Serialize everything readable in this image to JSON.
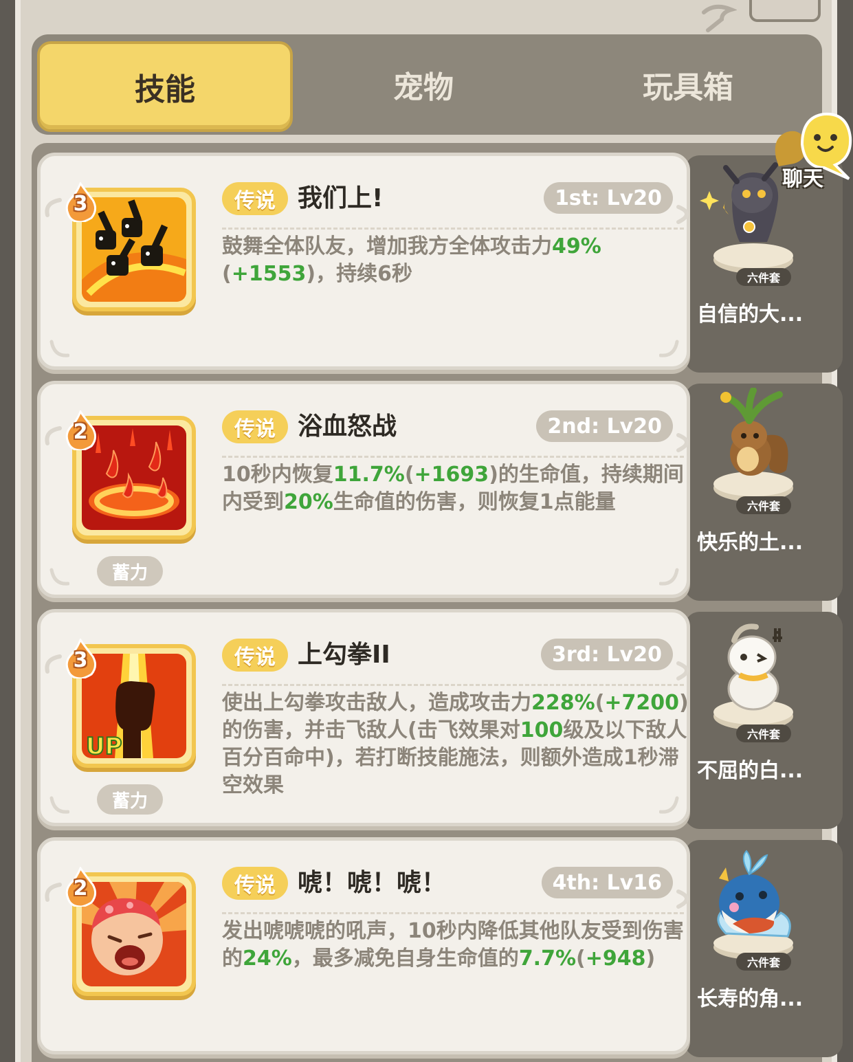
{
  "tabs": [
    {
      "label": "技能",
      "active": true
    },
    {
      "label": "宠物",
      "active": false
    },
    {
      "label": "玩具箱",
      "active": false
    }
  ],
  "chat": {
    "label": "聊天"
  },
  "skills": [
    {
      "level": "3",
      "rarity": "传说",
      "name": "我们上!",
      "slot": "1st: Lv20",
      "desc": [
        {
          "t": "鼓舞全体队友，增加我方全体攻击力",
          "g": false
        },
        {
          "t": "49%",
          "g": true
        },
        {
          "t": "(",
          "g": false
        },
        {
          "t": "+1553",
          "g": true
        },
        {
          "t": ")，持续6秒",
          "g": false
        }
      ],
      "charge": "",
      "icon": "rally-icon",
      "pet": {
        "set": "六件套",
        "name": "自信的大..."
      }
    },
    {
      "level": "2",
      "rarity": "传说",
      "name": "浴血怒战",
      "slot": "2nd: Lv20",
      "desc": [
        {
          "t": "10秒内恢复",
          "g": false
        },
        {
          "t": "11.7%",
          "g": true
        },
        {
          "t": "(",
          "g": false
        },
        {
          "t": "+1693",
          "g": true
        },
        {
          "t": ")的生命值，持续期间内受到",
          "g": false
        },
        {
          "t": "20%",
          "g": true
        },
        {
          "t": "生命值的伤害，则恢复1点能量",
          "g": false
        }
      ],
      "charge": "蓄力",
      "icon": "blood-drops-icon",
      "pet": {
        "set": "六件套",
        "name": "快乐的土..."
      }
    },
    {
      "level": "3",
      "rarity": "传说",
      "name": "上勾拳II",
      "slot": "3rd: Lv20",
      "desc": [
        {
          "t": "使出上勾拳攻击敌人，造成攻击力",
          "g": false
        },
        {
          "t": "228%",
          "g": true
        },
        {
          "t": "(",
          "g": false
        },
        {
          "t": "+7200",
          "g": true
        },
        {
          "t": ")的伤害，并击飞敌人(击飞效果对",
          "g": false
        },
        {
          "t": "100",
          "g": true
        },
        {
          "t": "级及以下敌人百分百命中)，若打断技能施法，则额外造成1秒滞空效果",
          "g": false
        }
      ],
      "charge": "蓄力",
      "icon": "uppercut-fist-icon",
      "icon_badge": "UP",
      "pet": {
        "set": "六件套",
        "name": "不屈的白..."
      }
    },
    {
      "level": "2",
      "rarity": "传说",
      "name": "唬！唬！唬！",
      "slot": "4th: Lv16",
      "desc": [
        {
          "t": "发出唬唬唬的吼声，10秒内降低其他队友受到伤害的",
          "g": false
        },
        {
          "t": "24%",
          "g": true
        },
        {
          "t": "，最多减免自身生命值的",
          "g": false
        },
        {
          "t": "7.7%",
          "g": true
        },
        {
          "t": "(",
          "g": false
        },
        {
          "t": "+948",
          "g": true
        },
        {
          "t": ")",
          "g": false
        }
      ],
      "charge": "",
      "icon": "roar-face-icon",
      "pet": {
        "set": "六件套",
        "name": "长寿的角..."
      }
    }
  ]
}
